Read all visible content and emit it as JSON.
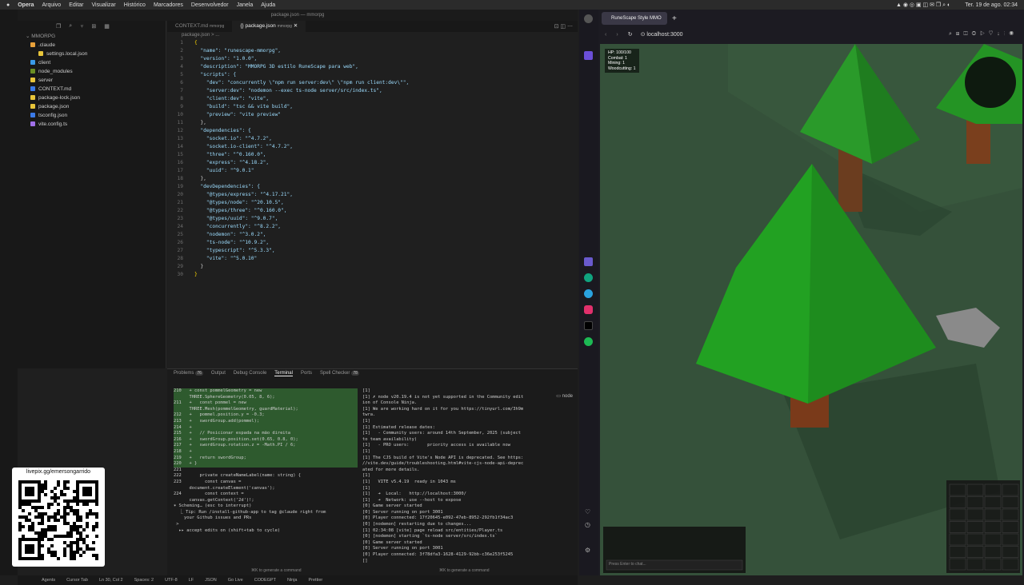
{
  "menubar": {
    "app": "Opera",
    "items": [
      "Arquivo",
      "Editar",
      "Visualizar",
      "Histórico",
      "Marcadores",
      "Desenvolvedor",
      "Janela",
      "Ajuda"
    ],
    "clock": "Ter. 19 de ago. 02:34"
  },
  "ide": {
    "window_title": "package.json — mmorpg",
    "explorer": {
      "root": "MMORPG",
      "items": [
        {
          "name": ".claude",
          "level": 0,
          "color": "#e8a13a"
        },
        {
          "name": "settings.local.json",
          "level": 1,
          "color": "#e8c53a"
        },
        {
          "name": "client",
          "level": 0,
          "color": "#3a9ae8"
        },
        {
          "name": "node_modules",
          "level": 0,
          "color": "#6b8e23"
        },
        {
          "name": "server",
          "level": 0,
          "color": "#e8c53a"
        },
        {
          "name": "CONTEXT.md",
          "level": 0,
          "color": "#3a7ae8"
        },
        {
          "name": "package-lock.json",
          "level": 0,
          "color": "#e8c53a"
        },
        {
          "name": "package.json",
          "level": 0,
          "color": "#e8c53a"
        },
        {
          "name": "tsconfig.json",
          "level": 0,
          "color": "#3a7ae8"
        },
        {
          "name": "vite.config.ts",
          "level": 0,
          "color": "#a070e8"
        }
      ]
    },
    "tabs": [
      {
        "label": "CONTEXT.md",
        "sub": "mmorpg",
        "active": false
      },
      {
        "label": "package.json",
        "sub": "mmorpg",
        "active": true
      }
    ],
    "breadcrumb": "package.json > ...",
    "code_lines": [
      "{",
      "  \"name\": \"runescape-mmorpg\",",
      "  \"version\": \"1.0.0\",",
      "  \"description\": \"MMORPG 3D estilo RuneScape para web\",",
      "  \"scripts\": {",
      "    \"dev\": \"concurrently \\\"npm run server:dev\\\" \\\"npm run client:dev\\\"\",",
      "    \"server:dev\": \"nodemon --exec ts-node server/src/index.ts\",",
      "    \"client:dev\": \"vite\",",
      "    \"build\": \"tsc && vite build\",",
      "    \"preview\": \"vite preview\"",
      "  },",
      "  \"dependencies\": {",
      "    \"socket.io\": \"^4.7.2\",",
      "    \"socket.io-client\": \"^4.7.2\",",
      "    \"three\": \"^0.160.0\",",
      "    \"express\": \"^4.18.2\",",
      "    \"uuid\": \"^9.0.1\"",
      "  },",
      "  \"devDependencies\": {",
      "    \"@types/express\": \"^4.17.21\",",
      "    \"@types/node\": \"^20.10.5\",",
      "    \"@types/three\": \"^0.160.0\",",
      "    \"@types/uuid\": \"^9.0.7\",",
      "    \"concurrently\": \"^8.2.2\",",
      "    \"nodemon\": \"^3.0.2\",",
      "    \"ts-node\": \"^10.9.2\",",
      "    \"typescript\": \"^5.3.3\",",
      "    \"vite\": \"^5.0.10\"",
      "  }",
      "}"
    ],
    "panel_tabs": [
      {
        "label": "Problems",
        "badge": "76"
      },
      {
        "label": "Output"
      },
      {
        "label": "Debug Console"
      },
      {
        "label": "Terminal",
        "active": true
      },
      {
        "label": "Ports"
      },
      {
        "label": "Spell Checker",
        "badge": "78"
      }
    ],
    "terminal_left": [
      "210   + const pommelGeometry = new",
      "      THREE.SphereGeometry(0.05, 8, 6);",
      "211   +   const pommel = new",
      "      THREE.Mesh(pommelGeometry, guardMaterial);",
      "212   +   pommel.position.y = -0.3;",
      "213   +   swordGroup.add(pommel);",
      "214   +",
      "215   +   // Posicionar espada na mão direita",
      "216   +   swordGroup.position.set(0.65, 0.8, 0);",
      "217   +   swordGroup.rotation.z = -Math.PI / 6;",
      "218   +",
      "219   +   return swordGroup;",
      "220   + }",
      "221",
      "222       private createNameLabel(name: string) {",
      "223         const canvas =",
      "      document.createElement('canvas');",
      "224         const context =",
      "      canvas.getContext('2d')!;",
      "",
      "✶ Scheming… (esc to interrupt)",
      "  ⎿ Tip: Run /install-github-app to tag @claude right from",
      "    your Github issues and PRs",
      "",
      "",
      " >",
      "",
      "  ▸▸ accept edits on (shift+tab to cycle)"
    ],
    "terminal_right": [
      "[1]",
      "[1] ✗ node v20.19.4 is not yet supported in the Community edit",
      "ion of Console Ninja.",
      "[1] We are working hard on it for you https://tinyurl.com/3h9m",
      "twra.",
      "[1]",
      "[1] Estimated release dates:",
      "[1]   - Community users: around 14th September, 2025 (subject",
      "to team availability)",
      "[1]   - PRO users:       priority access is available now",
      "[1]",
      "[1] The CJS build of Vite's Node API is deprecated. See https:",
      "//vite.dev/guide/troubleshooting.html#vite-cjs-node-api-deprec",
      "ated for more details.",
      "[1]",
      "[1]   VITE v5.4.19  ready in 1043 ms",
      "[1]",
      "[1]   ➜  Local:   http://localhost:3000/",
      "[1]   ➜  Network: use --host to expose",
      "[0] Game server started",
      "[0] Server running on port 3001",
      "[0] Player connected: 17f20645-e092-47eb-8952-292fb1f34ac3",
      "[0] [nodemon] restarting due to changes...",
      "[1] 02:34:08 [vite] page reload src/entities/Player.ts",
      "[0] [nodemon] starting `ts-node server/src/index.ts`",
      "[0] Game server started",
      "[0] Server running on port 3001",
      "[0] Player connected: 3f78dfa3-1628-4129-92bb-c36e253f5245",
      "[]"
    ],
    "panel_right_label": "node",
    "footer_hints": [
      "⌘K to generate a command",
      "⌘K to generate a command"
    ],
    "status": [
      "Agents",
      "Cursor Tab",
      "Ln 30, Col 2",
      "Spaces: 2",
      "UTF-8",
      "LF",
      "JSON",
      "Go Live",
      "CODEGPT",
      "Ninja",
      "Prettier"
    ]
  },
  "browser": {
    "tab_title": "RuneScape Style MMO",
    "url": "localhost:3000",
    "hud": [
      "HP: 100/100",
      "Combat: 1",
      "Mining: 1",
      "Woodcutting: 1"
    ],
    "chat_placeholder": "Press Enter to chat..."
  },
  "overlay": {
    "qr_label": "livepix.gg/emersongarrido"
  }
}
